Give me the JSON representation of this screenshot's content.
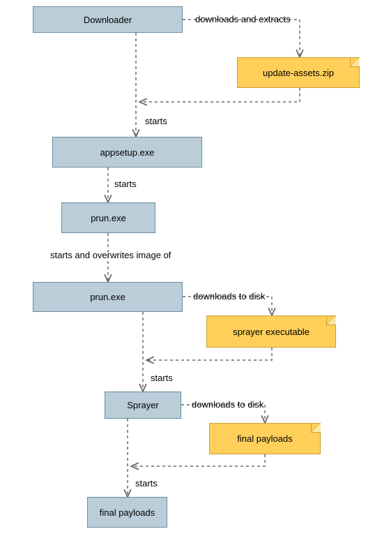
{
  "diagram": {
    "nodes": {
      "downloader": {
        "label": "Downloader"
      },
      "updatezip": {
        "label": "update-assets.zip"
      },
      "appsetup": {
        "label": "appsetup.exe"
      },
      "prun1": {
        "label": "prun.exe"
      },
      "prun2": {
        "label": "prun.exe"
      },
      "sprayerexe": {
        "label": "sprayer executable"
      },
      "sprayer": {
        "label": "Sprayer"
      },
      "finalnote": {
        "label": "final payloads"
      },
      "finalbox": {
        "label": "final payloads"
      }
    },
    "edges": {
      "e1": {
        "label": "downloads and extracts"
      },
      "e2": {
        "label": "starts"
      },
      "e3": {
        "label": "starts"
      },
      "e4": {
        "label": "starts and overwrites image of"
      },
      "e5": {
        "label": "downloads to disk"
      },
      "e6": {
        "label": "starts"
      },
      "e7": {
        "label": "downloads to disk"
      },
      "e8": {
        "label": "starts"
      }
    }
  },
  "chart_data": {
    "type": "flowchart",
    "title": "",
    "nodes": [
      {
        "id": "downloader",
        "kind": "process",
        "label": "Downloader"
      },
      {
        "id": "updatezip",
        "kind": "artifact",
        "label": "update-assets.zip"
      },
      {
        "id": "appsetup",
        "kind": "process",
        "label": "appsetup.exe"
      },
      {
        "id": "prun1",
        "kind": "process",
        "label": "prun.exe"
      },
      {
        "id": "prun2",
        "kind": "process",
        "label": "prun.exe"
      },
      {
        "id": "sprayerexe",
        "kind": "artifact",
        "label": "sprayer executable"
      },
      {
        "id": "sprayer",
        "kind": "process",
        "label": "Sprayer"
      },
      {
        "id": "finalnote",
        "kind": "artifact",
        "label": "final payloads"
      },
      {
        "id": "finalbox",
        "kind": "process",
        "label": "final payloads"
      }
    ],
    "edges": [
      {
        "from": "downloader",
        "to": "updatezip",
        "label": "downloads and extracts",
        "style": "dashed"
      },
      {
        "from": "updatezip",
        "to": "appsetup",
        "label": "",
        "style": "dashed-return"
      },
      {
        "from": "downloader",
        "to": "appsetup",
        "label": "starts",
        "style": "dashed"
      },
      {
        "from": "appsetup",
        "to": "prun1",
        "label": "starts",
        "style": "dashed"
      },
      {
        "from": "prun1",
        "to": "prun2",
        "label": "starts and overwrites image of",
        "style": "dashed"
      },
      {
        "from": "prun2",
        "to": "sprayerexe",
        "label": "downloads to disk",
        "style": "dashed"
      },
      {
        "from": "sprayerexe",
        "to": "sprayer",
        "label": "",
        "style": "dashed-return"
      },
      {
        "from": "prun2",
        "to": "sprayer",
        "label": "starts",
        "style": "dashed"
      },
      {
        "from": "sprayer",
        "to": "finalnote",
        "label": "downloads to disk",
        "style": "dashed"
      },
      {
        "from": "finalnote",
        "to": "finalbox",
        "label": "",
        "style": "dashed-return"
      },
      {
        "from": "sprayer",
        "to": "finalbox",
        "label": "starts",
        "style": "dashed"
      }
    ]
  },
  "colors": {
    "process_fill": "#bacdd8",
    "process_stroke": "#6e8a9e",
    "note_fill": "#ffcf5a",
    "note_stroke": "#c9a233",
    "line": "#6b6b6b"
  }
}
